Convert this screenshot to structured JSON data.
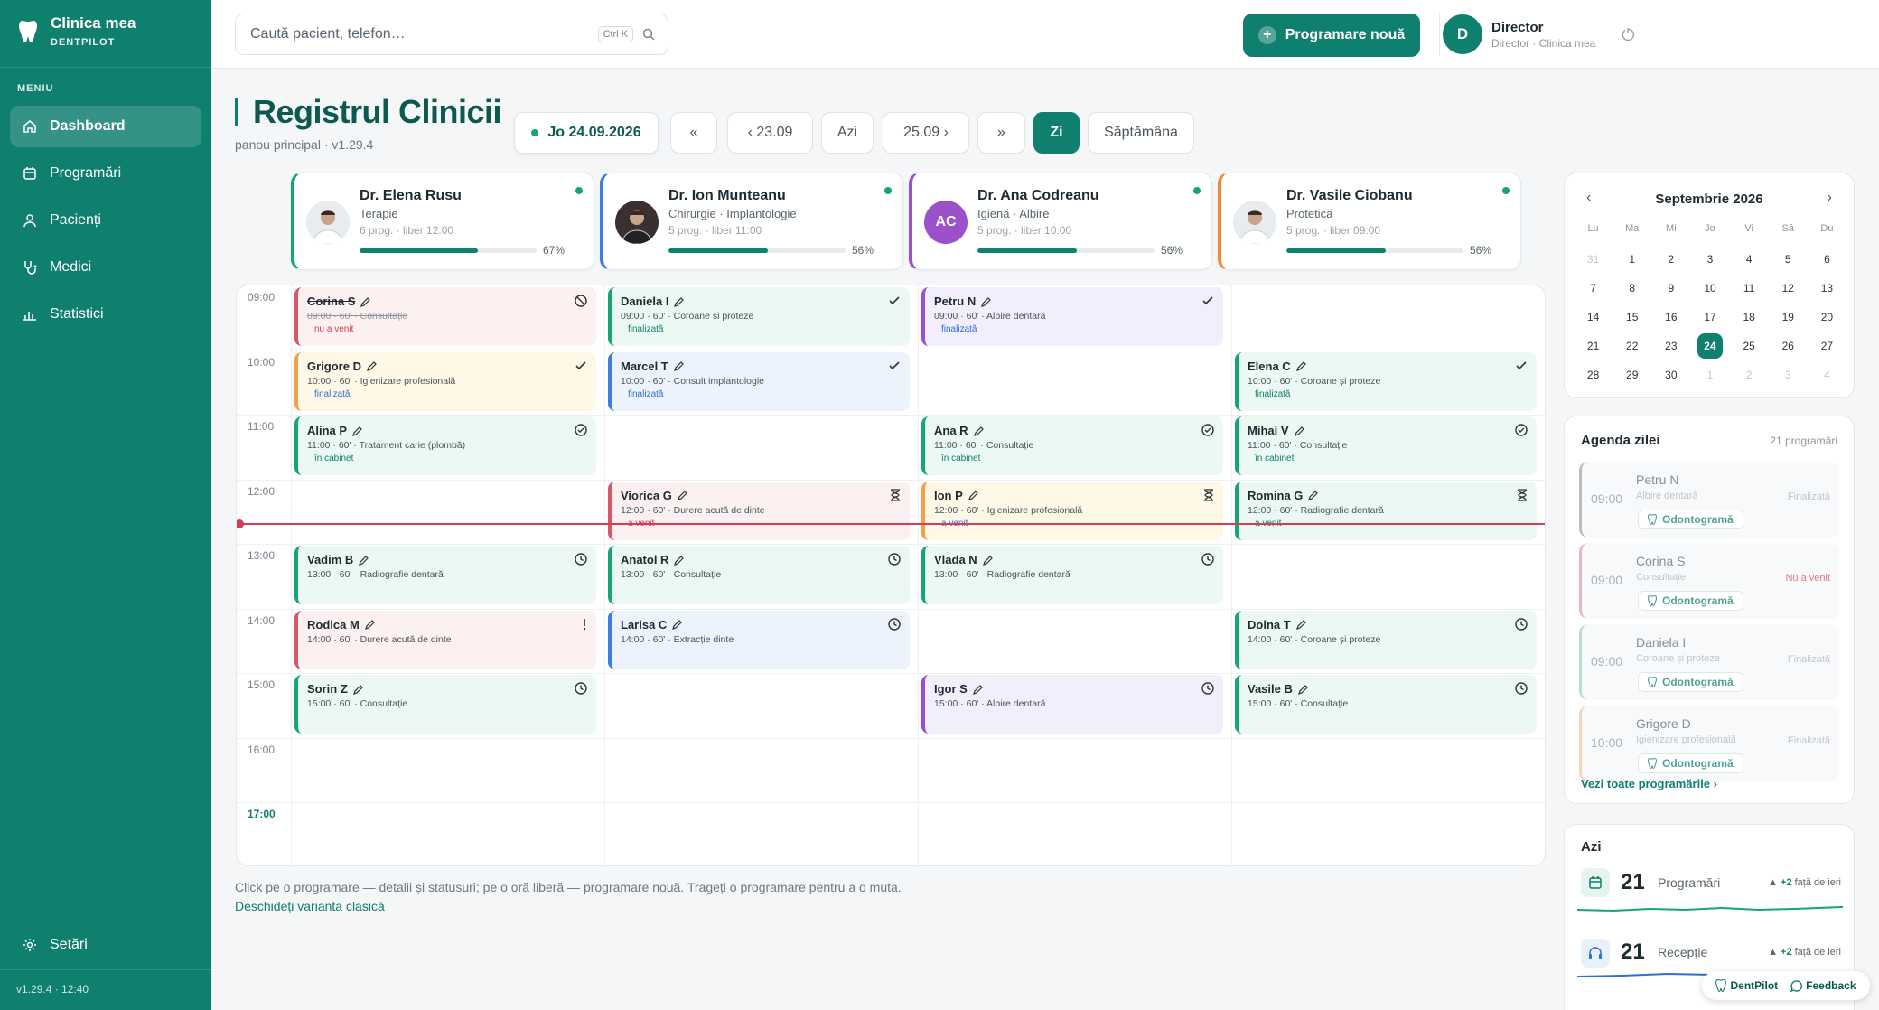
{
  "app": {
    "name": "Clinica mea",
    "sub": "DENTPILOT",
    "version": "v1.29.4 · 12:40"
  },
  "sidebar": {
    "menu_title": "MENIU",
    "items": [
      {
        "label": "Dashboard",
        "icon": "home-icon"
      },
      {
        "label": "Programări",
        "icon": "calendar-icon"
      },
      {
        "label": "Pacienți",
        "icon": "user-icon"
      },
      {
        "label": "Medici",
        "icon": "stethoscope-icon"
      },
      {
        "label": "Statistici",
        "icon": "bar-chart-icon"
      }
    ],
    "settings": "Setări"
  },
  "topbar": {
    "search_placeholder": "Caută pacient, telefon…",
    "search_shortcut": "Ctrl K",
    "new_button": "Programare nouă",
    "user_initial": "D",
    "user_name": "Director",
    "user_role": "Director · Clinica mea"
  },
  "header": {
    "title": "Registrul Clinicii",
    "subtitle": "panou principal · v1.29.4",
    "date": "Jo 24.09.2026",
    "prev_week": "«",
    "prev_day": "‹ 23.09",
    "today": "Azi",
    "next_day": "25.09 ›",
    "next_week": "»",
    "view_day": "Zi",
    "view_week": "Săptămâna"
  },
  "doctors": [
    {
      "name": "Dr. Elena Rusu",
      "spec": "Terapie",
      "meta": "6 prog. · liber 12:00",
      "pct": "67%",
      "fill": 0.67,
      "color": "#16a37a",
      "avatar": "photo"
    },
    {
      "name": "Dr. Ion Munteanu",
      "spec": "Chirurgie · Implantologie",
      "meta": "5 prog. · liber 11:00",
      "pct": "56%",
      "fill": 0.56,
      "color": "#3b7de0",
      "avatar": "photo-dark"
    },
    {
      "name": "Dr. Ana Codreanu",
      "spec": "Igienă · Albire",
      "meta": "5 prog. · liber 10:00",
      "pct": "56%",
      "fill": 0.56,
      "color": "#9b51c9",
      "avatar": "AC"
    },
    {
      "name": "Dr. Vasile Ciobanu",
      "spec": "Protetică",
      "meta": "5 prog. · liber 09:00",
      "pct": "56%",
      "fill": 0.56,
      "color": "#f08a3c",
      "avatar": "photo"
    }
  ],
  "hours": [
    "09:00",
    "10:00",
    "11:00",
    "12:00",
    "13:00",
    "14:00",
    "15:00",
    "16:00",
    "17:00"
  ],
  "appointments": [
    {
      "col": 0,
      "row": 0,
      "name": "Corina S",
      "det": "09:00 · 60' · Consultație",
      "status": "nu a venit",
      "theme": "red",
      "icon": "ban",
      "struck": true
    },
    {
      "col": 0,
      "row": 1,
      "name": "Grigore D",
      "det": "10:00 · 60' · Igienizare profesională",
      "status": "finalizată",
      "theme": "yellow",
      "icon": "check"
    },
    {
      "col": 0,
      "row": 2,
      "name": "Alina P",
      "det": "11:00 · 60' · Tratament carie (plombă)",
      "status": "în cabinet",
      "theme": "green",
      "icon": "check-circle"
    },
    {
      "col": 0,
      "row": 4,
      "name": "Vadim B",
      "det": "13:00 · 60' · Radiografie dentară",
      "status": "",
      "theme": "green",
      "icon": "clock"
    },
    {
      "col": 0,
      "row": 5,
      "name": "Rodica M",
      "det": "14:00 · 60' · Durere acută de dinte",
      "status": "",
      "theme": "red",
      "icon": "exclaim"
    },
    {
      "col": 0,
      "row": 6,
      "name": "Sorin Z",
      "det": "15:00 · 60' · Consultație",
      "status": "",
      "theme": "green",
      "icon": "clock"
    },
    {
      "col": 1,
      "row": 0,
      "name": "Daniela I",
      "det": "09:00 · 60' · Coroane și proteze",
      "status": "finalizată",
      "theme": "green",
      "icon": "check"
    },
    {
      "col": 1,
      "row": 1,
      "name": "Marcel T",
      "det": "10:00 · 60' · Consult implantologie",
      "status": "finalizată",
      "theme": "blue",
      "icon": "check"
    },
    {
      "col": 1,
      "row": 3,
      "name": "Viorica G",
      "det": "12:00 · 60' · Durere acută de dinte",
      "status": "a venit",
      "theme": "red",
      "icon": "hourglass"
    },
    {
      "col": 1,
      "row": 4,
      "name": "Anatol R",
      "det": "13:00 · 60' · Consultație",
      "status": "",
      "theme": "green",
      "icon": "clock"
    },
    {
      "col": 1,
      "row": 5,
      "name": "Larisa C",
      "det": "14:00 · 60' · Extracție dinte",
      "status": "",
      "theme": "blue",
      "icon": "clock"
    },
    {
      "col": 2,
      "row": 0,
      "name": "Petru N",
      "det": "09:00 · 60' · Albire dentară",
      "status": "finalizată",
      "theme": "purple",
      "icon": "check"
    },
    {
      "col": 2,
      "row": 2,
      "name": "Ana R",
      "det": "11:00 · 60' · Consultație",
      "status": "în cabinet",
      "theme": "green",
      "icon": "check-circle"
    },
    {
      "col": 2,
      "row": 3,
      "name": "Ion P",
      "det": "12:00 · 60' · Igienizare profesională",
      "status": "a venit",
      "theme": "yellow",
      "icon": "hourglass"
    },
    {
      "col": 2,
      "row": 4,
      "name": "Vlada N",
      "det": "13:00 · 60' · Radiografie dentară",
      "status": "",
      "theme": "green",
      "icon": "clock"
    },
    {
      "col": 2,
      "row": 6,
      "name": "Igor S",
      "det": "15:00 · 60' · Albire dentară",
      "status": "",
      "theme": "purple",
      "icon": "clock"
    },
    {
      "col": 3,
      "row": 1,
      "name": "Elena C",
      "det": "10:00 · 60' · Coroane și proteze",
      "status": "finalizată",
      "theme": "green",
      "icon": "check"
    },
    {
      "col": 3,
      "row": 2,
      "name": "Mihai V",
      "det": "11:00 · 60' · Consultație",
      "status": "în cabinet",
      "theme": "green",
      "icon": "check-circle"
    },
    {
      "col": 3,
      "row": 3,
      "name": "Romina G",
      "det": "12:00 · 60' · Radiografie dentară",
      "status": "a venit",
      "theme": "green",
      "icon": "hourglass"
    },
    {
      "col": 3,
      "row": 5,
      "name": "Doina T",
      "det": "14:00 · 60' · Coroane și proteze",
      "status": "",
      "theme": "green",
      "icon": "clock"
    },
    {
      "col": 3,
      "row": 6,
      "name": "Vasile B",
      "det": "15:00 · 60' · Consultație",
      "status": "",
      "theme": "green",
      "icon": "clock"
    }
  ],
  "hint": "Click pe o programare — detalii și statusuri; pe o oră liberă — programare nouă. Trageți o programare pentru a o muta.",
  "hint_link": "Deschideți varianta clasică",
  "calendar": {
    "title": "Septembrie 2026",
    "weekdays": [
      "Lu",
      "Ma",
      "Mi",
      "Jo",
      "Vi",
      "Sâ",
      "Du"
    ],
    "days": [
      {
        "d": "31",
        "m": true
      },
      {
        "d": "1"
      },
      {
        "d": "2"
      },
      {
        "d": "3"
      },
      {
        "d": "4"
      },
      {
        "d": "5"
      },
      {
        "d": "6"
      },
      {
        "d": "7"
      },
      {
        "d": "8"
      },
      {
        "d": "9"
      },
      {
        "d": "10"
      },
      {
        "d": "11"
      },
      {
        "d": "12"
      },
      {
        "d": "13"
      },
      {
        "d": "14"
      },
      {
        "d": "15"
      },
      {
        "d": "16"
      },
      {
        "d": "17"
      },
      {
        "d": "18"
      },
      {
        "d": "19"
      },
      {
        "d": "20"
      },
      {
        "d": "21"
      },
      {
        "d": "22"
      },
      {
        "d": "23"
      },
      {
        "d": "24",
        "t": true
      },
      {
        "d": "25"
      },
      {
        "d": "26"
      },
      {
        "d": "27"
      },
      {
        "d": "28"
      },
      {
        "d": "29"
      },
      {
        "d": "30"
      },
      {
        "d": "1",
        "m": true
      },
      {
        "d": "2",
        "m": true
      },
      {
        "d": "3",
        "m": true
      },
      {
        "d": "4",
        "m": true
      }
    ]
  },
  "agenda": {
    "title": "Agenda zilei",
    "count": "21 programări",
    "button": "Odontogramă",
    "items": [
      {
        "time": "09:00",
        "name": "Petru N",
        "svc": "Albire dentară",
        "badge": "Finalizată",
        "color": "#9aa4ab"
      },
      {
        "time": "09:00",
        "name": "Corina S",
        "svc": "Consultație",
        "badge": "Nu a venit",
        "color": "#e79aa6",
        "red": true
      },
      {
        "time": "09:00",
        "name": "Daniela I",
        "svc": "Coroane și proteze",
        "badge": "Finalizată",
        "color": "#9fd4c2"
      },
      {
        "time": "10:00",
        "name": "Grigore D",
        "svc": "Igienizare profesională",
        "badge": "Finalizată",
        "color": "#f5c69a"
      }
    ],
    "all_link": "Vezi toate programările ›"
  },
  "stats": {
    "title": "Azi",
    "items": [
      {
        "num": "21",
        "label": "Programări",
        "delta": "+2",
        "delta_txt": "față de ieri",
        "icon": "calendar-icon"
      },
      {
        "num": "21",
        "label": "Recepție",
        "delta": "+2",
        "delta_txt": "față de ieri",
        "icon": "headset-icon"
      }
    ]
  },
  "fab": {
    "brand": "DentPilot",
    "feedback": "Feedback"
  },
  "colors": {
    "primary": "#0f7f6e",
    "now_line": "#d43d55"
  }
}
